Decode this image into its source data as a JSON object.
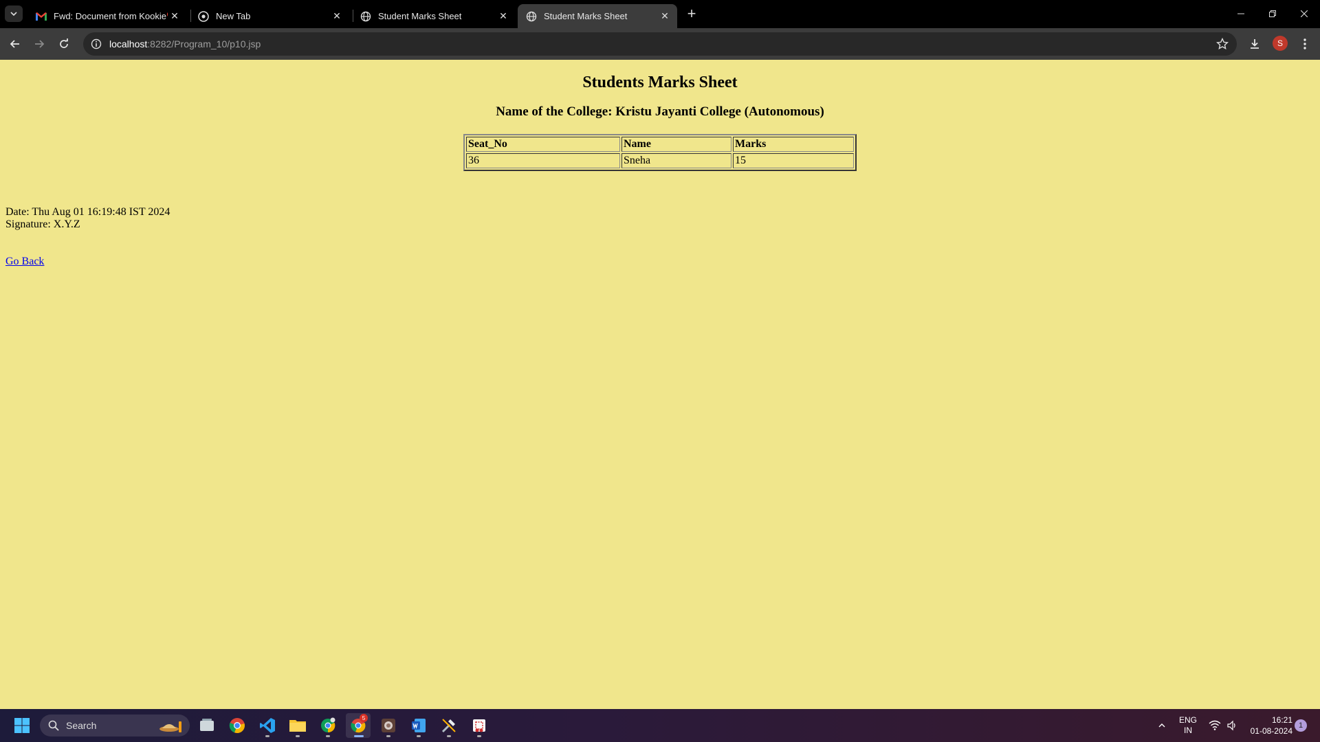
{
  "browser": {
    "tabs": [
      {
        "title": "Fwd: Document from Kookie❤️",
        "icon": "gmail-icon",
        "active": false
      },
      {
        "title": "New Tab",
        "icon": "chrome-icon",
        "active": false
      },
      {
        "title": "Student Marks Sheet",
        "icon": "globe-icon",
        "active": false
      },
      {
        "title": "Student Marks Sheet",
        "icon": "globe-icon",
        "active": true
      }
    ],
    "url_host": "localhost",
    "url_path": ":8282/Program_10/p10.jsp",
    "profile_initial": "S"
  },
  "page": {
    "title": "Students Marks Sheet",
    "college_line": "Name of the College: Kristu Jayanti College (Autonomous)",
    "table": {
      "headers": [
        "Seat_No",
        "Name",
        "Marks"
      ],
      "rows": [
        [
          "36",
          "Sneha",
          "15"
        ]
      ]
    },
    "date_line": "Date: Thu Aug 01 16:19:48 IST 2024",
    "signature_line": "Signature: X.Y.Z",
    "go_back_label": "Go Back",
    "background_color": "#f0e68c"
  },
  "taskbar": {
    "search_label": "Search",
    "apps": [
      "file-explorer-icon",
      "chrome-icon",
      "vscode-icon",
      "folder-icon",
      "chrome-profile-icon",
      "chrome-active-icon",
      "app-icon",
      "word-icon",
      "tools-icon",
      "snipping-icon"
    ],
    "chrome_badge": "5",
    "lang_line1": "ENG",
    "lang_line2": "IN",
    "time": "16:21",
    "date": "01-08-2024",
    "notification_count": "1"
  }
}
